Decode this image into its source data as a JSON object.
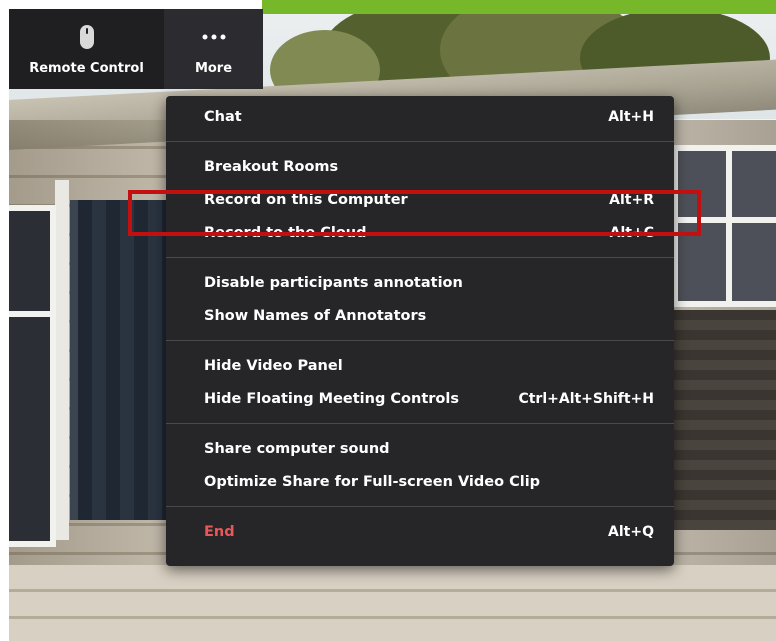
{
  "toolbar": {
    "buttons": [
      {
        "label": "Remote Control",
        "icon": "mouse-icon"
      },
      {
        "label": "More",
        "icon": "ellipsis-icon"
      }
    ]
  },
  "menu": {
    "groups": [
      [
        {
          "label": "Chat",
          "shortcut": "Alt+H"
        }
      ],
      [
        {
          "label": "Breakout Rooms",
          "shortcut": ""
        },
        {
          "label": "Record on this Computer",
          "shortcut": "Alt+R"
        },
        {
          "label": "Record to the Cloud",
          "shortcut": "Alt+C"
        }
      ],
      [
        {
          "label": "Disable participants annotation",
          "shortcut": ""
        },
        {
          "label": "Show Names of Annotators",
          "shortcut": ""
        }
      ],
      [
        {
          "label": "Hide Video Panel",
          "shortcut": ""
        },
        {
          "label": "Hide Floating Meeting Controls",
          "shortcut": "Ctrl+Alt+Shift+H"
        }
      ],
      [
        {
          "label": "Share computer sound",
          "shortcut": ""
        },
        {
          "label": "Optimize Share for Full-screen Video Clip",
          "shortcut": ""
        }
      ],
      [
        {
          "label": "End",
          "shortcut": "Alt+Q"
        }
      ]
    ]
  },
  "highlight": {
    "target": "Record on this Computer",
    "color": "#c20f10"
  },
  "colors": {
    "menu_bg": "#262629",
    "end_text": "#e8585b",
    "green_bar": "#76b82a"
  }
}
